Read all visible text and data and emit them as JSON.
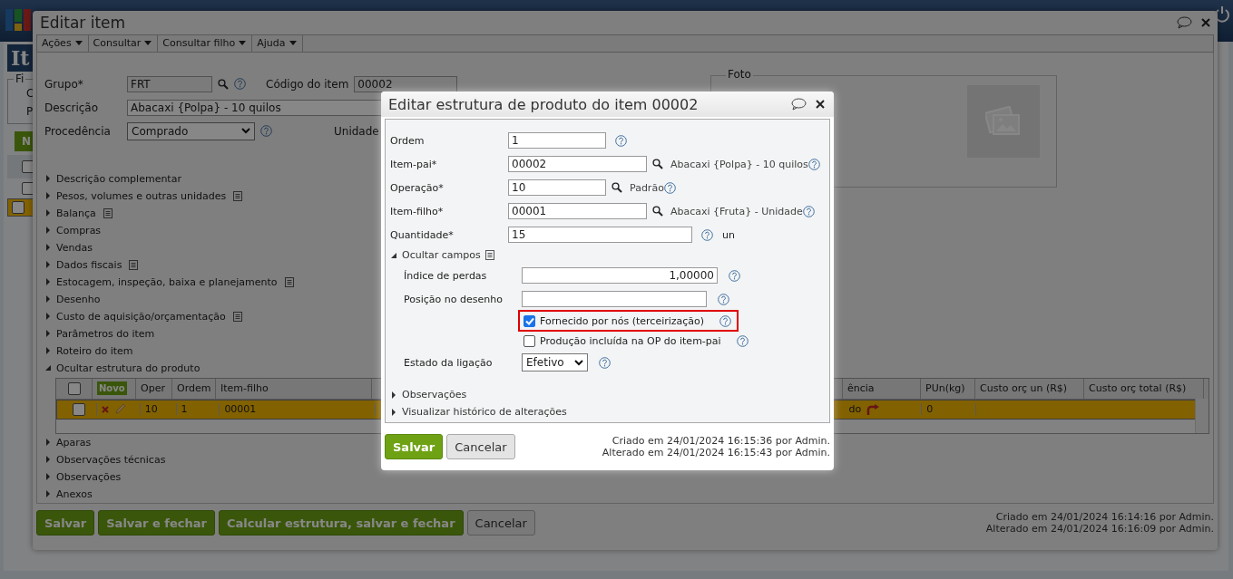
{
  "app": {
    "title": "It",
    "filter_legend": "Fi",
    "filter_labels": [
      "C",
      "P"
    ],
    "new_button": "N",
    "select_all_checked": false,
    "rows": [
      {
        "selected": false,
        "checked": false
      },
      {
        "selected": true,
        "checked": false
      }
    ]
  },
  "window": {
    "title": "Editar item",
    "menu": [
      "Ações",
      "Consultar",
      "Consultar filho",
      "Ajuda"
    ],
    "form": {
      "group_label": "Grupo*",
      "group_value": "FRT",
      "code_label": "Código do item",
      "code_value": "00002",
      "description_label": "Descrição",
      "description_value": "Abacaxi {Polpa} - 10 quilos",
      "origin_label": "Procedência",
      "origin_value": "Comprado",
      "unit_label": "Unidade"
    },
    "photo": {
      "legend": "Foto"
    },
    "sections": [
      {
        "label": "Descrição complementar",
        "has_notes": false,
        "expanded": false
      },
      {
        "label": "Pesos, volumes e outras unidades",
        "has_notes": true,
        "expanded": false
      },
      {
        "label": "Balança",
        "has_notes": true,
        "expanded": false
      },
      {
        "label": "Compras",
        "has_notes": false,
        "expanded": false
      },
      {
        "label": "Vendas",
        "has_notes": false,
        "expanded": false
      },
      {
        "label": "Dados fiscais",
        "has_notes": true,
        "expanded": false
      },
      {
        "label": "Estocagem, inspeção, baixa e planejamento",
        "has_notes": true,
        "expanded": false
      },
      {
        "label": "Desenho",
        "has_notes": false,
        "expanded": false
      },
      {
        "label": "Custo de aquisição/orçamentação",
        "has_notes": true,
        "expanded": false
      },
      {
        "label": "Parâmetros do item",
        "has_notes": false,
        "expanded": false
      },
      {
        "label": "Roteiro do item",
        "has_notes": false,
        "expanded": false
      },
      {
        "label": "Ocultar estrutura do produto",
        "has_notes": false,
        "expanded": true
      },
      {
        "label": "Aparas",
        "has_notes": false,
        "expanded": false
      },
      {
        "label": "Observações técnicas",
        "has_notes": false,
        "expanded": false
      },
      {
        "label": "Observações",
        "has_notes": false,
        "expanded": false
      },
      {
        "label": "Anexos",
        "has_notes": false,
        "expanded": false
      }
    ],
    "structure_table": {
      "new_button": "Novo",
      "select_all_checked": false,
      "columns": [
        "Oper",
        "Ordem",
        "Item-filho",
        "ência",
        "PUn(kg)",
        "Custo orç un (R$)",
        "Custo orç total (R$)"
      ],
      "rows": [
        {
          "selected": true,
          "checked": false,
          "cells": [
            "10",
            "1",
            "00001",
            "do",
            "0"
          ]
        }
      ]
    },
    "buttons": [
      {
        "label": "Salvar",
        "kind": "primary"
      },
      {
        "label": "Salvar e fechar",
        "kind": "primary"
      },
      {
        "label": "Calcular estrutura, salvar e fechar",
        "kind": "primary"
      },
      {
        "label": "Cancelar",
        "kind": "secondary"
      }
    ],
    "info": [
      "Criado em 24/01/2024 16:14:16 por Admin.",
      "Alterado em 24/01/2024 16:16:09 por Admin."
    ]
  },
  "dialog": {
    "title": "Editar estrutura de produto do item 00002",
    "fields": [
      {
        "kind": "text",
        "label": "Ordem",
        "value": "1"
      },
      {
        "kind": "lookup",
        "label": "Item-pai*",
        "value": "00002",
        "description": "Abacaxi {Polpa} - 10 quilos"
      },
      {
        "kind": "lookup",
        "label": "Operação*",
        "value": "10",
        "description": "Padrão"
      },
      {
        "kind": "lookup",
        "label": "Item-filho*",
        "value": "00001",
        "description": "Abacaxi {Fruta} - Unidade"
      },
      {
        "kind": "text",
        "label": "Quantidade*",
        "value": "15",
        "unit": "un"
      }
    ],
    "hidden_fields_toggle": {
      "label": "Ocultar campos",
      "expanded": true
    },
    "sub_fields": [
      {
        "kind": "number",
        "label": "Índice de perdas",
        "value": "1,00000"
      },
      {
        "kind": "text",
        "label": "Posição no desenho"
      },
      {
        "kind": "checkbox",
        "label": "Fornecido por nós (terceirização)",
        "checked": true,
        "highlighted": true
      },
      {
        "kind": "checkbox",
        "label": "Produção incluída na OP do item-pai",
        "checked": false,
        "highlighted": false
      },
      {
        "kind": "select",
        "label": "Estado da ligação",
        "value": "Efetivo"
      }
    ],
    "sections": [
      {
        "label": "Observações",
        "expanded": false
      },
      {
        "label": "Visualizar histórico de alterações",
        "expanded": false
      }
    ],
    "buttons": [
      {
        "label": "Salvar",
        "kind": "primary"
      },
      {
        "label": "Cancelar",
        "kind": "secondary"
      }
    ],
    "info": [
      "Criado em 24/01/2024 16:15:36 por Admin.",
      "Alterado em 24/01/2024 16:15:43 por Admin."
    ]
  }
}
